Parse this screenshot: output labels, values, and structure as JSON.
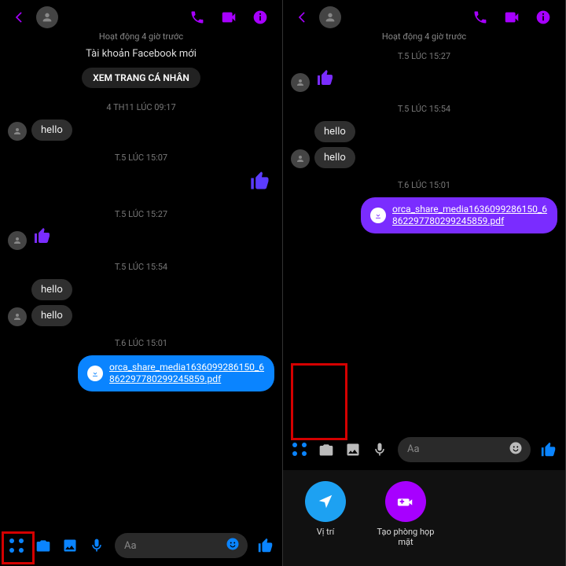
{
  "colors": {
    "accent": "#a700ff",
    "blue": "#0a84ff",
    "like": "#5b3cff"
  },
  "left": {
    "status": "Hoạt động 4 giờ trước",
    "subline": "Tài khoản Facebook mới",
    "profile_btn": "XEM TRANG CÁ NHÂN",
    "ts1": "4 TH11 LÚC 09:17",
    "msg1": "hello",
    "ts2": "T.5 LÚC 15:07",
    "ts3": "T.5 LÚC 15:27",
    "ts4": "T.5 LÚC 15:54",
    "msg2": "hello",
    "msg3": "hello",
    "ts5": "T.6 LÚC 15:01",
    "file": "orca_share_media1636099286150_68622977802992458​59.pdf",
    "composer_placeholder": "Aa"
  },
  "right": {
    "status": "Hoạt động 4 giờ trước",
    "ts1": "T.5 LÚC 15:27",
    "ts2": "T.5 LÚC 15:54",
    "msg1": "hello",
    "msg2": "hello",
    "ts3": "T.6 LÚC 15:01",
    "file": "orca_share_media1636099286150_68622977802992458​59.pdf",
    "composer_placeholder": "Aa",
    "drawer": {
      "location": "Vị trí",
      "room": "Tạo phòng họp mặt"
    }
  }
}
